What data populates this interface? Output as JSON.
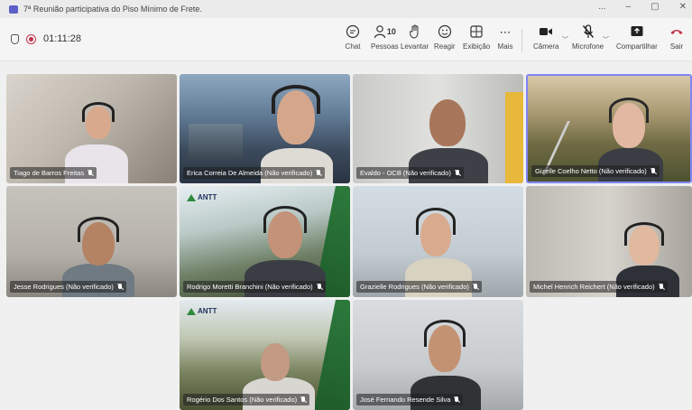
{
  "window": {
    "title": "7ª Reunião participativa do Piso Mínimo de Frete.",
    "controls": [
      "...",
      "–",
      "▢",
      "✕"
    ]
  },
  "toolbar": {
    "timer": "01:11:28",
    "buttons": {
      "chat": "Chat",
      "people": "Pessoas",
      "people_count": "10",
      "raise": "Levantar",
      "react": "Reagir",
      "view": "Exibição",
      "more": "Mais",
      "camera": "Câmera",
      "mic": "Microfone",
      "share": "Compartilhar",
      "leave": "Sair"
    }
  },
  "participants": [
    {
      "name": "Tiago de Barros Freitas"
    },
    {
      "name": "Erica Correia De Almeida (Não verificado)"
    },
    {
      "name": "Evaldo - OCB (Não verificado)"
    },
    {
      "name": "Gizelle Coelho Netto (Não verificado)"
    },
    {
      "name": "Jesse Rodrigues (Não verificado)"
    },
    {
      "name": "Rodrigo Moretti Branchini (Não verificado)"
    },
    {
      "name": "Grazielle Rodrigues (Não verificado)"
    },
    {
      "name": "Michel Henrich Reichert (Não verificado)"
    },
    {
      "name": "Rogério Dos Santos (Não verificado)"
    },
    {
      "name": "José Fernando Resende Silva"
    }
  ],
  "brand": {
    "antt_label": "ANTT"
  }
}
